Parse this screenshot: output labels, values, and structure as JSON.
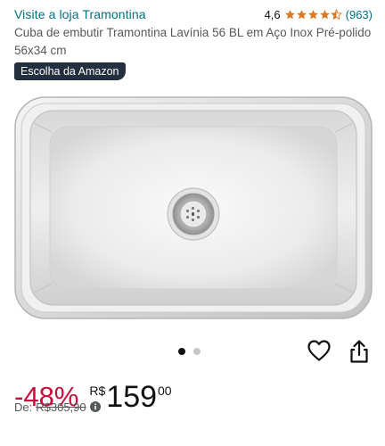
{
  "store": {
    "link_text": "Visite a loja Tramontina"
  },
  "rating": {
    "value": "4,6",
    "stars": 4.5,
    "count": "(963)"
  },
  "product": {
    "title": "Cuba de embutir Tramontina Lavínia 56 BL em Aço Inox Pré-polido 56x34 cm",
    "badge_prefix": "Escolha da ",
    "badge_brand": "Amazon"
  },
  "carousel": {
    "total": 2,
    "active": 1
  },
  "price": {
    "discount": "-48%",
    "currency": "R$",
    "whole": "159",
    "fraction": "00",
    "was_label": "De:",
    "was_value": "R$305,90"
  },
  "colors": {
    "link": "#007185",
    "star": "#de7921",
    "discount": "#cc0c39",
    "badge_bg": "#232f3e"
  },
  "icons": {
    "favorite": "heart-icon",
    "share": "share-icon",
    "info": "info-icon",
    "star": "star-icon"
  }
}
